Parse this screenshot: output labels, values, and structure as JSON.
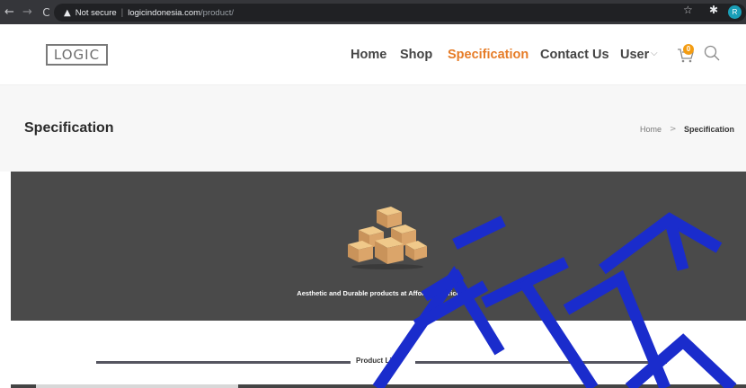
{
  "browser": {
    "security_warning": "Not secure",
    "url_host": "logicindonesia.com",
    "url_path": "/product/",
    "profile_initial": "R"
  },
  "header": {
    "logo_text": "LOGIC",
    "nav": [
      {
        "label": "Home",
        "active": false
      },
      {
        "label": "Shop",
        "active": false
      },
      {
        "label": "Specification",
        "active": true
      },
      {
        "label": "Contact Us",
        "active": false
      },
      {
        "label": "User",
        "active": false
      }
    ],
    "cart_count": "0",
    "accent_color": "#e67c27"
  },
  "title_bar": {
    "title": "Specification",
    "breadcrumb": {
      "home": "Home",
      "separator": ">",
      "current": "Specification"
    }
  },
  "banner": {
    "image": "cardboard-boxes-icon",
    "caption": "Aesthetic and Durable products at Affordable price"
  },
  "product_list": {
    "label": "Product List"
  },
  "watermark": {
    "text": "TEKIKA",
    "color": "#1a2ccc"
  }
}
